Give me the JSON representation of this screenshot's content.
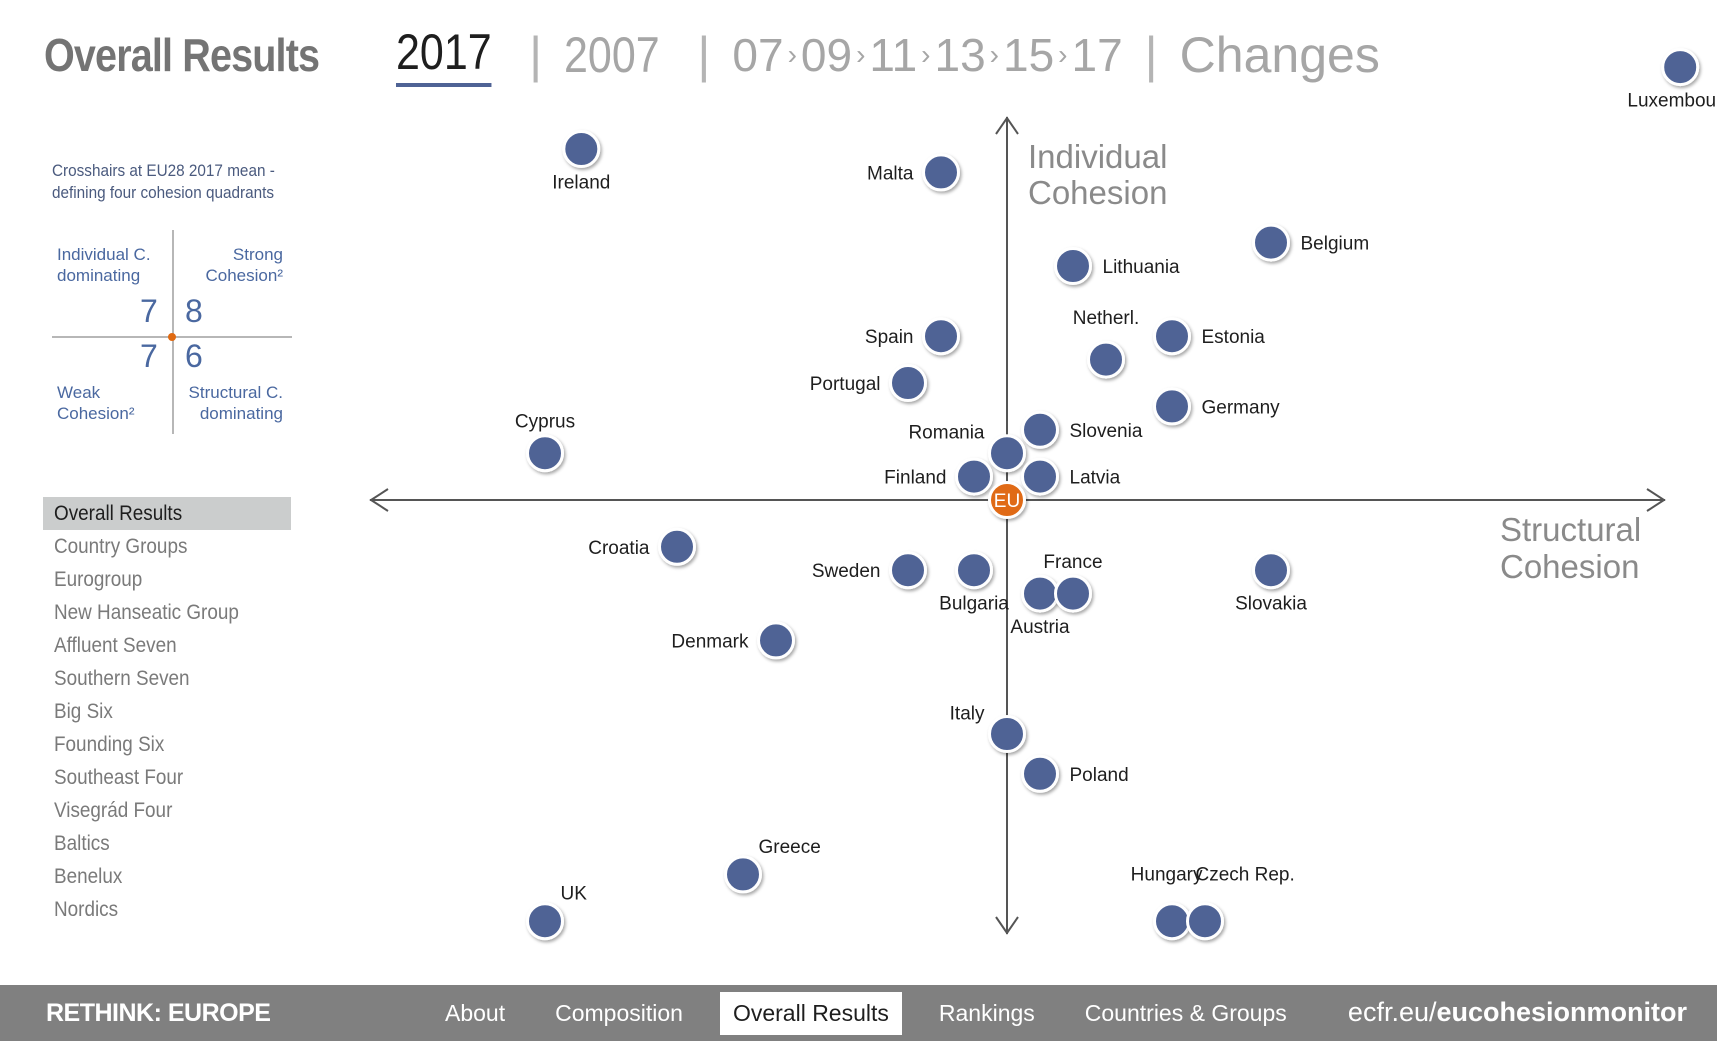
{
  "header": {
    "title": "Overall Results",
    "year_tabs": [
      {
        "label": "2017",
        "active": true
      },
      {
        "label": "2007",
        "active": false
      }
    ],
    "steps": [
      "07",
      "09",
      "11",
      "13",
      "15",
      "17"
    ],
    "step_separator_icon": "chevron-right-icon",
    "changes_label": "Changes"
  },
  "legend": {
    "note_line1": "Crosshairs at EU28 2017 mean -",
    "note_line2": "defining four cohesion quadrants",
    "quadrants": {
      "top_left": {
        "line1": "Individual C.",
        "line2": "dominating",
        "count": "7"
      },
      "top_right": {
        "line1": "Strong",
        "line2": "Cohesion²",
        "count": "8"
      },
      "bottom_left": {
        "line1": "Weak",
        "line2": "Cohesion²",
        "count": "7"
      },
      "bottom_right": {
        "line1": "Structural C.",
        "line2": "dominating",
        "count": "6"
      }
    }
  },
  "sidebar": {
    "items": [
      {
        "label": "Overall Results",
        "active": true
      },
      {
        "label": "Country Groups"
      },
      {
        "label": "Eurogroup"
      },
      {
        "label": "New Hanseatic Group"
      },
      {
        "label": "Affluent Seven"
      },
      {
        "label": "Southern Seven"
      },
      {
        "label": "Big Six"
      },
      {
        "label": "Founding Six"
      },
      {
        "label": "Southeast Four"
      },
      {
        "label": "Visegrád Four"
      },
      {
        "label": "Baltics"
      },
      {
        "label": "Benelux"
      },
      {
        "label": "Nordics"
      }
    ]
  },
  "footer": {
    "brand": "RETHINK: EUROPE",
    "tabs": [
      {
        "label": "About"
      },
      {
        "label": "Composition"
      },
      {
        "label": "Overall Results",
        "active": true
      },
      {
        "label": "Rankings"
      },
      {
        "label": "Countries & Groups"
      }
    ],
    "url_prefix": "ecfr.eu/",
    "url_bold": "eucohesionmonitor"
  },
  "colors": {
    "dot": "#4f6395",
    "eu_dot": "#e06a12",
    "axis": "#555555"
  },
  "chart_data": {
    "type": "scatter",
    "title": "Overall Results 2017",
    "xlabel": "Structural Cohesion",
    "ylabel": "Individual Cohesion",
    "origin_label": "EU",
    "origin_note": "Crosshairs at EU28 2017 mean",
    "units": "offset from EU28 mean (relative units)",
    "xlim": [
      -19,
      21
    ],
    "ylim": [
      -20,
      19
    ],
    "grid": false,
    "points": [
      {
        "name": "Luxembourg",
        "x": 20.4,
        "y": 18.5,
        "label_pos": "below"
      },
      {
        "name": "Ireland",
        "x": -12.9,
        "y": 15,
        "label_pos": "below"
      },
      {
        "name": "Malta",
        "x": -2,
        "y": 14,
        "label_pos": "left"
      },
      {
        "name": "Lithuania",
        "x": 2,
        "y": 10,
        "label_pos": "right"
      },
      {
        "name": "Belgium",
        "x": 8,
        "y": 11,
        "label_pos": "right"
      },
      {
        "name": "Spain",
        "x": -2,
        "y": 7,
        "label_pos": "left"
      },
      {
        "name": "Netherl.",
        "x": 3,
        "y": 6,
        "label_pos": "above"
      },
      {
        "name": "Estonia",
        "x": 5,
        "y": 7,
        "label_pos": "right"
      },
      {
        "name": "Portugal",
        "x": -3,
        "y": 5,
        "label_pos": "left"
      },
      {
        "name": "Germany",
        "x": 5,
        "y": 4,
        "label_pos": "right"
      },
      {
        "name": "Cyprus",
        "x": -14,
        "y": 2,
        "label_pos": "above"
      },
      {
        "name": "Slovenia",
        "x": 1,
        "y": 3,
        "label_pos": "right"
      },
      {
        "name": "Romania",
        "x": 0,
        "y": 2,
        "label_pos": "upper-left"
      },
      {
        "name": "Finland",
        "x": -1,
        "y": 1,
        "label_pos": "left"
      },
      {
        "name": "Latvia",
        "x": 1,
        "y": 1,
        "label_pos": "right"
      },
      {
        "name": "Croatia",
        "x": -10,
        "y": -2,
        "label_pos": "left"
      },
      {
        "name": "Sweden",
        "x": -3,
        "y": -3,
        "label_pos": "left"
      },
      {
        "name": "Bulgaria",
        "x": -1,
        "y": -3,
        "label_pos": "below"
      },
      {
        "name": "Slovakia",
        "x": 8,
        "y": -3,
        "label_pos": "below"
      },
      {
        "name": "Austria",
        "x": 1,
        "y": -4,
        "label_pos": "below"
      },
      {
        "name": "France",
        "x": 2,
        "y": -4,
        "label_pos": "above"
      },
      {
        "name": "Denmark",
        "x": -7,
        "y": -6,
        "label_pos": "left"
      },
      {
        "name": "Italy",
        "x": 0,
        "y": -10,
        "label_pos": "upper-left"
      },
      {
        "name": "Poland",
        "x": 1,
        "y": -11.7,
        "label_pos": "right"
      },
      {
        "name": "Greece",
        "x": -8,
        "y": -16,
        "label_pos": "upper-right"
      },
      {
        "name": "UK",
        "x": -14,
        "y": -18,
        "label_pos": "upper-right"
      },
      {
        "name": "Hungary",
        "x": 5,
        "y": -18,
        "label_pos": "above-left"
      },
      {
        "name": "Czech Rep.",
        "x": 6,
        "y": -18,
        "label_pos": "above-right"
      }
    ]
  }
}
